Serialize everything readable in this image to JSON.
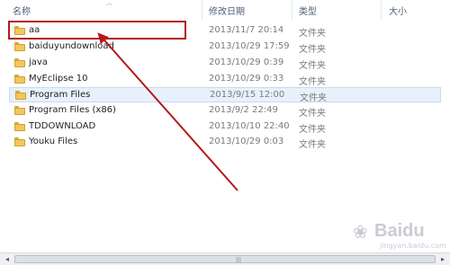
{
  "columns": {
    "name": "名称",
    "date": "修改日期",
    "type": "类型",
    "size": "大小"
  },
  "rows": [
    {
      "name": "aa",
      "date": "2013/11/7 20:14",
      "type": "文件夹"
    },
    {
      "name": "baiduyundownload",
      "date": "2013/10/29 17:59",
      "type": "文件夹"
    },
    {
      "name": "java",
      "date": "2013/10/29 0:39",
      "type": "文件夹"
    },
    {
      "name": "MyEclipse 10",
      "date": "2013/10/29 0:33",
      "type": "文件夹"
    },
    {
      "name": "Program Files",
      "date": "2013/9/15 12:00",
      "type": "文件夹"
    },
    {
      "name": "Program Files (x86)",
      "date": "2013/9/2 22:49",
      "type": "文件夹"
    },
    {
      "name": "TDDOWNLOAD",
      "date": "2013/10/10 22:40",
      "type": "文件夹"
    },
    {
      "name": "Youku Files",
      "date": "2013/10/29 0:03",
      "type": "文件夹"
    }
  ],
  "selected_row": "Program Files",
  "icons": {
    "folder": "folder-icon",
    "sort": "sort-up-icon",
    "scroll_left": "scroll-left-icon",
    "scroll_right": "scroll-right-icon"
  },
  "annotation": {
    "color": "#b51a1a"
  },
  "watermark": {
    "text": "Bai",
    "symbol": "du",
    "sub": "jingyan.baidu.com"
  }
}
